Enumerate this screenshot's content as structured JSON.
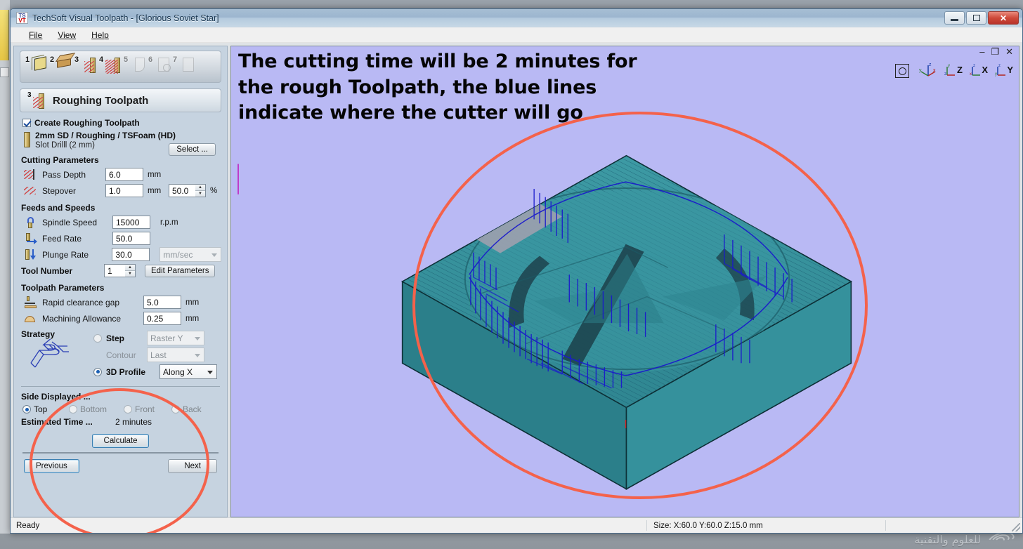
{
  "window": {
    "title": "TechSoft Visual Toolpath - [Glorious Soviet Star]",
    "app_icon_top": "TS",
    "app_icon_bottom": "VT",
    "minimize_label": "Minimize",
    "maximize_label": "Restore",
    "close_label": "Close"
  },
  "menu": {
    "items": [
      {
        "label": "File",
        "accel": "F"
      },
      {
        "label": "View",
        "accel": "V"
      },
      {
        "label": "Help",
        "accel": "H"
      }
    ]
  },
  "mdi": {
    "minimize": "–",
    "restore": "❐",
    "close": "✕"
  },
  "steps": {
    "items": [
      {
        "number": "1",
        "name": "setup-material",
        "enabled": true
      },
      {
        "number": "2",
        "name": "design-model",
        "enabled": true
      },
      {
        "number": "3",
        "name": "roughing-toolpath",
        "enabled": true
      },
      {
        "number": "4",
        "name": "finishing-toolpath",
        "enabled": true
      },
      {
        "number": "5",
        "name": "cutout-toolpath",
        "enabled": false
      },
      {
        "number": "6",
        "name": "preview",
        "enabled": false
      },
      {
        "number": "7",
        "name": "export",
        "enabled": false
      }
    ]
  },
  "panel": {
    "step_number": "3",
    "step_title": "Roughing Toolpath",
    "create_checkbox": {
      "label": "Create Roughing Toolpath",
      "checked": true
    },
    "tool": {
      "name": "2mm SD / Roughing / TSFoam (HD)",
      "detail": "Slot Drilll (2 mm)",
      "select_button": "Select ..."
    },
    "cutting_parameters": {
      "header": "Cutting Parameters",
      "pass_depth": {
        "label": "Pass Depth",
        "value": "6.0",
        "unit": "mm"
      },
      "stepover": {
        "label": "Stepover",
        "value": "1.0",
        "unit": "mm",
        "percent": "50.0",
        "percent_unit": "%"
      }
    },
    "feeds_and_speeds": {
      "header": "Feeds and Speeds",
      "spindle_speed": {
        "label": "Spindle Speed",
        "value": "15000",
        "unit": "r.p.m"
      },
      "feed_rate": {
        "label": "Feed Rate",
        "value": "50.0"
      },
      "plunge_rate": {
        "label": "Plunge Rate",
        "value": "30.0"
      },
      "rate_unit_select": "mm/sec",
      "tool_number": {
        "label": "Tool Number",
        "value": "1"
      },
      "edit_parameters_button": "Edit Parameters"
    },
    "toolpath_parameters": {
      "header": "Toolpath Parameters",
      "rapid_clearance_gap": {
        "label": "Rapid clearance gap",
        "value": "5.0",
        "unit": "mm"
      },
      "machining_allowance": {
        "label": "Machining Allowance",
        "value": "0.25",
        "unit": "mm"
      }
    },
    "strategy": {
      "header": "Strategy",
      "step": {
        "label": "Step",
        "selected": false,
        "select_value": "Raster Y",
        "enabled": false
      },
      "contour": {
        "label": "Contour",
        "select_value": "Last",
        "enabled": false
      },
      "profile_3d": {
        "label": "3D Profile",
        "selected": true,
        "select_value": "Along X",
        "enabled": true
      }
    },
    "side_displayed": {
      "header": "Side Displayed ...",
      "options": [
        {
          "label": "Top",
          "selected": true,
          "enabled": true
        },
        {
          "label": "Bottom",
          "selected": false,
          "enabled": false
        },
        {
          "label": "Front",
          "selected": false,
          "enabled": false
        },
        {
          "label": "Back",
          "selected": false,
          "enabled": false
        }
      ]
    },
    "estimated_time": {
      "label": "Estimated Time ...",
      "value": "2 minutes"
    },
    "calculate_button": "Calculate",
    "previous_button": "Previous",
    "next_button": "Next"
  },
  "viewport": {
    "annotation": "The cutting time will be 2 minutes for the rough Toolpath, the blue lines indicate where the cutter will go",
    "view_buttons": [
      {
        "name": "fit-to-window",
        "label": ""
      },
      {
        "name": "isometric-view",
        "label": ""
      },
      {
        "name": "top-view-z",
        "label": "Z"
      },
      {
        "name": "front-view-x",
        "label": "X"
      },
      {
        "name": "side-view-y",
        "label": "Y"
      }
    ],
    "axis_labels": {
      "x": "x",
      "y": "y",
      "z": "z"
    },
    "background_color": "#b9b9f4",
    "model_color": "#2e8b96",
    "toolpath_color": "#1a1acc",
    "annotation_circle_color": "#f4624b"
  },
  "status_bar": {
    "message": "Ready",
    "size_text": "Size: X:60.0 Y:60.0 Z:15.0 mm"
  },
  "watermark": {
    "text": "للعلوم والتقنية"
  }
}
